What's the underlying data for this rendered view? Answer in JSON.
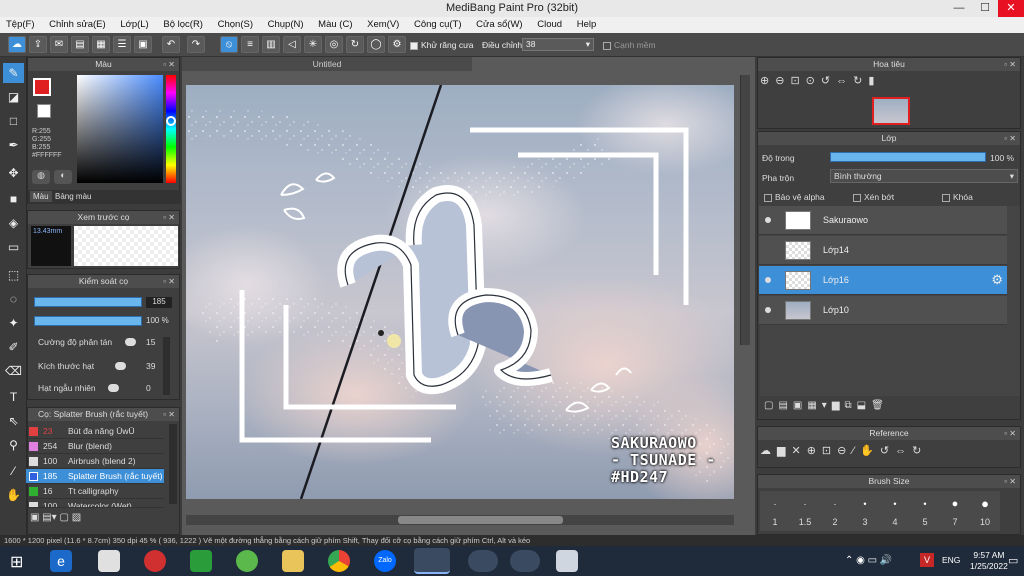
{
  "window": {
    "title": "MediBang Paint Pro (32bit)",
    "minimize": "—",
    "maximize": "☐",
    "close": "✕"
  },
  "menu": [
    "Tệp(F)",
    "Chỉnh sửa(E)",
    "Lớp(L)",
    "Bộ lọc(R)",
    "Chọn(S)",
    "Chụp(N)",
    "Màu (C)",
    "Xem(V)",
    "Công cụ(T)",
    "Cửa sổ(W)",
    "Cloud",
    "Help"
  ],
  "toolbar": {
    "antialias_label": "Khử răng cưa",
    "adjust_label": "Điều chỉnh",
    "adjust_value": "38",
    "smooth_label": "Cạnh mềm"
  },
  "color_panel": {
    "title": "Màu",
    "r": "R:255",
    "g": "G:255",
    "b": "B:255",
    "hex": "#FFFFFF",
    "tab_color": "Màu",
    "tab_palette": "Bảng màu",
    "accent": "#3d8fd8"
  },
  "brush_preview": {
    "title": "Xem trước cọ",
    "size": "13.43mm"
  },
  "brush_control": {
    "title": "Kiểm soát cọ",
    "size_value": "185",
    "opacity_value": "100 %",
    "scatter_label": "Cường độ phân tán",
    "scatter_value": "15",
    "grain_label": "Kích thước hạt",
    "grain_value": "39",
    "random_label": "Hạt ngẫu nhiên",
    "random_value": "0"
  },
  "brush_list": {
    "title": "Cọ: Splatter Brush (rắc tuyết)",
    "items": [
      {
        "num": "23",
        "name": "Bút đa năng ŪwŪ",
        "color": "#e04040"
      },
      {
        "num": "254",
        "name": "Blur (blend)",
        "color": "#e080e0"
      },
      {
        "num": "100",
        "name": "Airbrush (blend 2)",
        "color": "#dddddd"
      },
      {
        "num": "185",
        "name": "Splatter Brush (rắc tuyết)",
        "color": "#3060e0"
      },
      {
        "num": "16",
        "name": "Tt calligraphy",
        "color": "#30b030"
      },
      {
        "num": "100",
        "name": "Watercolor (Wet)",
        "color": "#dddddd"
      }
    ]
  },
  "canvas": {
    "tab": "Untitled",
    "watermark": [
      "SAKURAOWO",
      "- TSUNADE -",
      "#HD247"
    ]
  },
  "navigator": {
    "title": "Hoa tiêu"
  },
  "layers": {
    "title": "Lớp",
    "opacity_label": "Độ trong",
    "opacity_value": "100 %",
    "blend_label": "Pha trộn",
    "blend_value": "Bình thường",
    "protect_alpha": "Bảo vệ alpha",
    "clipping": "Xén bớt",
    "lock": "Khóa",
    "items": [
      {
        "name": "Sakuraowo",
        "selected": false
      },
      {
        "name": "Lớp14",
        "selected": false
      },
      {
        "name": "Lớp16",
        "selected": true
      },
      {
        "name": "Lớp10",
        "selected": false
      }
    ]
  },
  "reference": {
    "title": "Reference"
  },
  "brush_size": {
    "title": "Brush Size",
    "sizes": [
      "1",
      "1.5",
      "2",
      "3",
      "4",
      "5",
      "7",
      "10"
    ]
  },
  "status": {
    "text": "1600 * 1200 pixel  (11.6 * 8.7cm)  350 dpi  45 %  ( 936, 1222 )  Vẽ một đường thẳng bằng cách giữ phím Shift, Thay đổi cỡ cọ bằng cách giữ phím Ctrl, Alt và kéo"
  },
  "taskbar": {
    "lang": "ENG",
    "time": "9:57 AM",
    "date": "1/25/2022",
    "zalo": "Zalo"
  }
}
